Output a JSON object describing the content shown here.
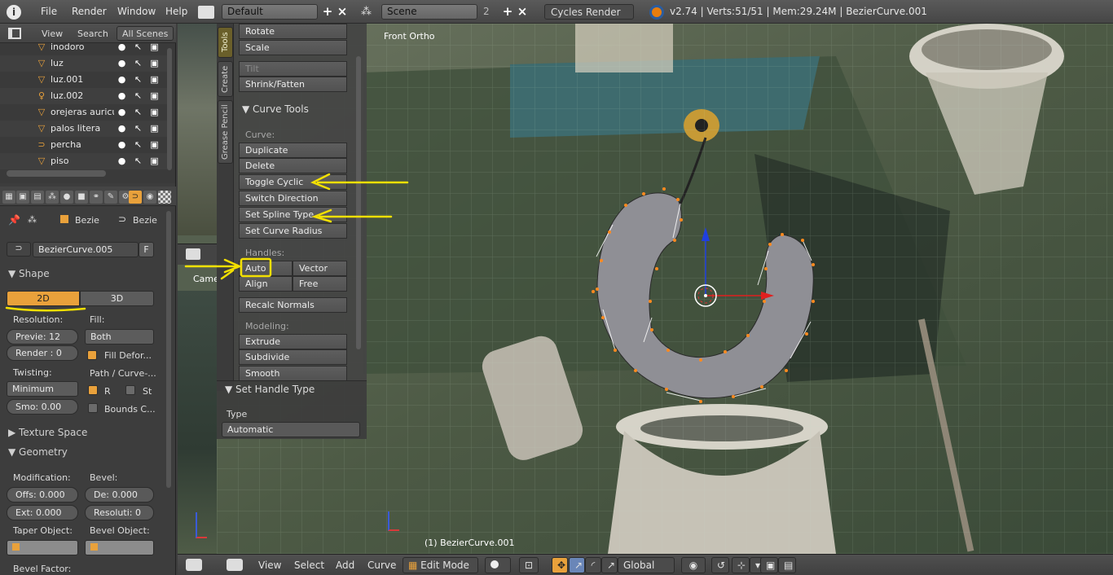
{
  "topbar": {
    "menu": [
      "File",
      "Render",
      "Window",
      "Help"
    ],
    "layout": "Default",
    "scene": "Scene",
    "scene_users": "2",
    "engine": "Cycles Render",
    "stats": "v2.74 | Verts:51/51 | Mem:29.24M | BezierCurve.001"
  },
  "outliner": {
    "header": [
      "View",
      "Search",
      "All Scenes"
    ],
    "items": [
      {
        "name": "inodoro",
        "icon": "mesh-icon"
      },
      {
        "name": "luz",
        "icon": "mesh-icon"
      },
      {
        "name": "luz.001",
        "icon": "mesh-icon"
      },
      {
        "name": "luz.002",
        "icon": "lamp-icon"
      },
      {
        "name": "orejeras auricul",
        "icon": "mesh-icon"
      },
      {
        "name": "palos litera",
        "icon": "mesh-icon"
      },
      {
        "name": "percha",
        "icon": "curve-icon"
      },
      {
        "name": "piso",
        "icon": "mesh-icon"
      }
    ]
  },
  "properties": {
    "breadcrumb": [
      "Bezie",
      "Bezie"
    ],
    "datablock": "BezierCurve.005",
    "datablock_flag": "F",
    "shape_panel": "Shape",
    "dim_2d": "2D",
    "dim_3d": "3D",
    "resolution_label": "Resolution:",
    "fill_label": "Fill:",
    "preview": "Previe: 12",
    "render": "Render : 0",
    "fill_value": "Both",
    "fill_deform": "Fill Defor...",
    "twisting_label": "Twisting:",
    "path_label": "Path / Curve-...",
    "twist_value": "Minimum",
    "r_label": "R",
    "st_label": "St",
    "smooth": "Smo: 0.00",
    "bounds": "Bounds C...",
    "texture_space": "Texture Space",
    "geometry": "Geometry",
    "modification_label": "Modification:",
    "bevel_label": "Bevel:",
    "offset": "Offs: 0.000",
    "depth": "De: 0.000",
    "extrude": "Ext: 0.000",
    "resolution": "Resoluti: 0",
    "taper_label": "Taper Object:",
    "bevel_object_label": "Bevel Object:",
    "bevel_factor_label": "Bevel Factor:"
  },
  "tool_tabs": [
    "Tools",
    "Create",
    "Grease Pencil"
  ],
  "tools": {
    "top_buttons": [
      "Rotate",
      "Scale"
    ],
    "tilt": "Tilt",
    "shrink": "Shrink/Fatten",
    "curve_tools_header": "Curve Tools",
    "curve_label": "Curve:",
    "curve_buttons": [
      "Duplicate",
      "Delete",
      "Toggle Cyclic",
      "Switch Direction",
      "Set Spline Type",
      "Set Curve Radius"
    ],
    "handles_label": "Handles:",
    "handles": [
      "Auto",
      "Vector",
      "Align",
      "Free"
    ],
    "recalc": "Recalc Normals",
    "modeling_label": "Modeling:",
    "modeling_buttons": [
      "Extrude",
      "Subdivide",
      "Smooth"
    ]
  },
  "operator_panel": {
    "title": "Set Handle Type",
    "type_label": "Type",
    "type_value": "Automatic"
  },
  "viewport": {
    "view_label": "Front Ortho",
    "object_label": "(1) BezierCurve.001",
    "camera_label": "Came"
  },
  "bottombar": {
    "menus": [
      "View",
      "Select",
      "Add",
      "Curve"
    ],
    "mode": "Edit Mode",
    "orientation": "Global"
  },
  "colors": {
    "accent": "#e9a13b",
    "annotation": "#f3e000",
    "curve_fill": "#8f8f95",
    "vertex": "#ff8a1f"
  }
}
